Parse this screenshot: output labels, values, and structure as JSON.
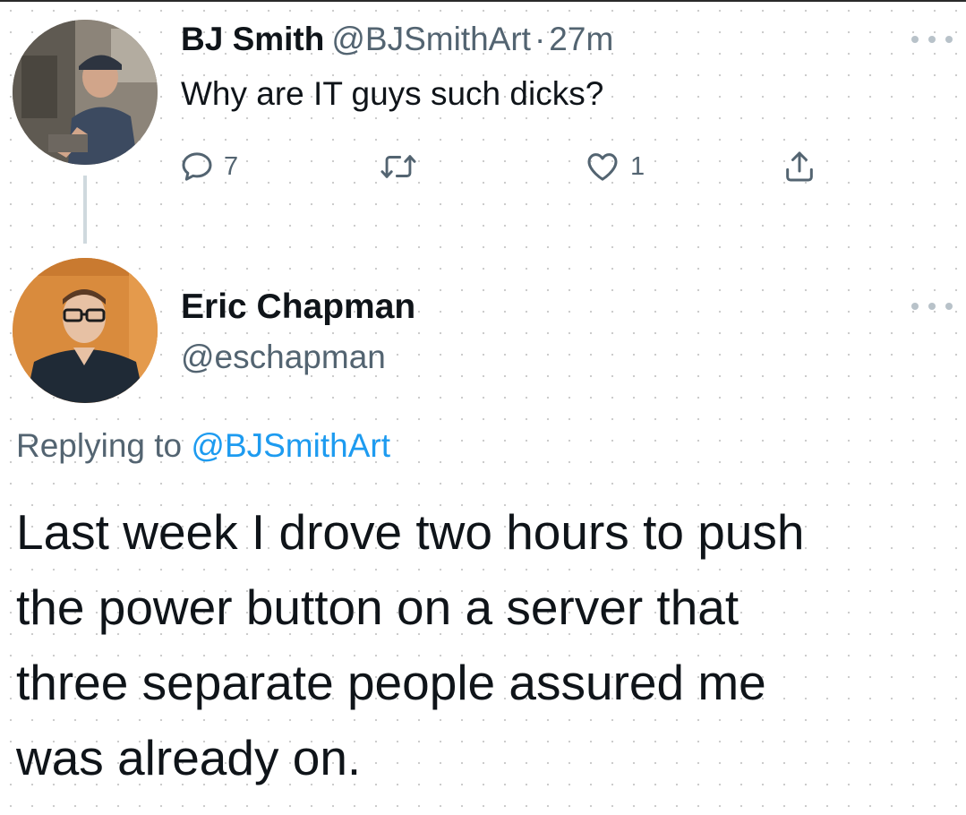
{
  "tweet": {
    "author": {
      "display_name": "BJ Smith",
      "handle": "@BJSmithArt",
      "separator": "·",
      "time": "27m"
    },
    "text": "Why are IT guys such dicks?",
    "actions": {
      "reply_count": "7",
      "retweet_count": "",
      "like_count": "1"
    }
  },
  "reply": {
    "author": {
      "display_name": "Eric Chapman",
      "handle": "@eschapman"
    },
    "replying_to_prefix": "Replying to",
    "replying_to_handle": "@BJSmithArt",
    "text_lines": [
      "Last week I drove two hours to push",
      "the power button on a server that",
      "three separate people assured me",
      "was already on."
    ]
  },
  "icons": [
    "more-icon",
    "reply-icon",
    "retweet-icon",
    "like-icon",
    "share-icon"
  ],
  "colors": {
    "text_primary": "#0f1419",
    "text_secondary": "#536471",
    "link": "#1d9bf0",
    "thread_line": "#cfd9de"
  }
}
